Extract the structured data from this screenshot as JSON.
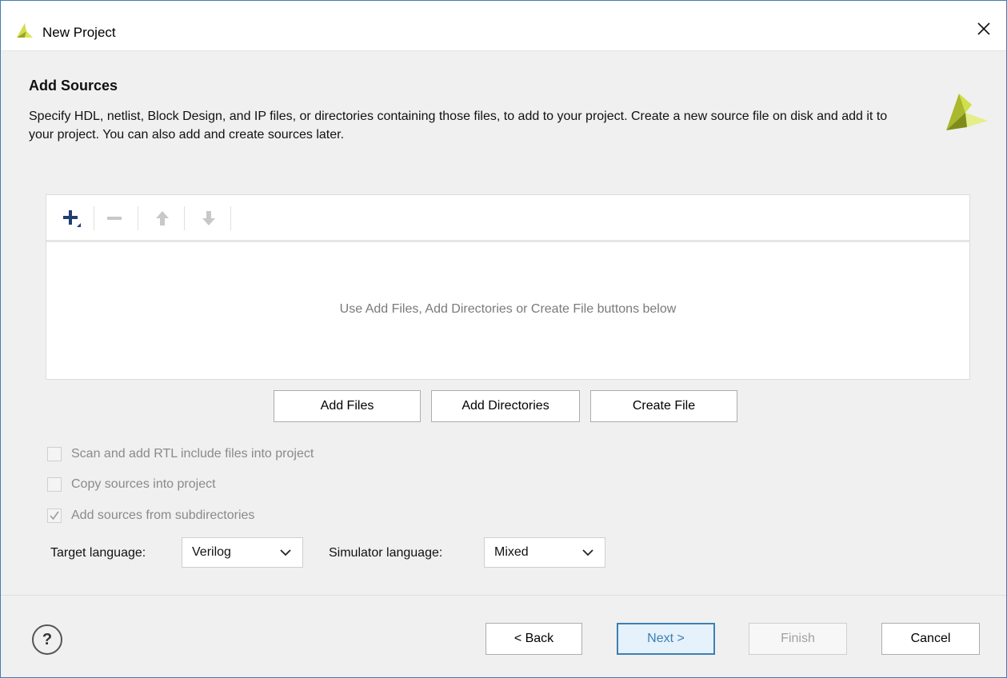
{
  "window": {
    "title": "New Project",
    "close_symbol": "×"
  },
  "header": {
    "title": "Add Sources",
    "description": "Specify HDL, netlist, Block Design, and IP files, or directories containing those files, to add to your project. Create a new source file on disk and add it to your project. You can also add and create sources later."
  },
  "icons": {
    "title_logo": "vivado-logo-icon",
    "header_logo": "vivado-logo-icon",
    "toolbar": [
      "add-plus-icon",
      "remove-minus-icon",
      "move-up-icon",
      "move-down-icon"
    ]
  },
  "sources_panel": {
    "empty_hint": "Use Add Files, Add Directories or Create File buttons below"
  },
  "buttons": {
    "add_files": "Add Files",
    "add_directories": "Add Directories",
    "create_file": "Create File"
  },
  "options": [
    {
      "label": "Scan and add RTL include files into project",
      "checked": false,
      "enabled": false
    },
    {
      "label": "Copy sources into project",
      "checked": false,
      "enabled": false
    },
    {
      "label": "Add sources from subdirectories",
      "checked": true,
      "enabled": false
    }
  ],
  "languages": {
    "target_label": "Target language:",
    "target_value": "Verilog",
    "simulator_label": "Simulator language:",
    "simulator_value": "Mixed"
  },
  "footer": {
    "help": "?",
    "back": "< Back",
    "next": "Next >",
    "finish": "Finish",
    "cancel": "Cancel"
  },
  "colors": {
    "accent": "#3c7fb1",
    "logo_green": "#cfe04a",
    "logo_olive": "#9aa624"
  }
}
